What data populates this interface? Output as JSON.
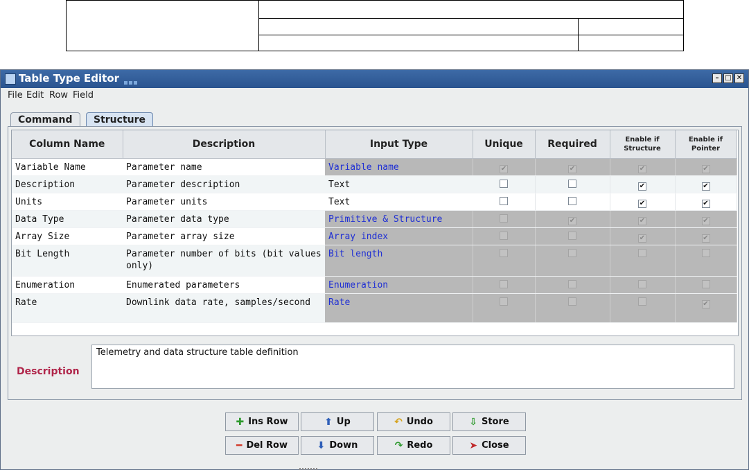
{
  "window": {
    "title": "Table Type Editor",
    "controls": [
      "–",
      "□",
      "✕"
    ]
  },
  "menu": [
    "File",
    "Edit",
    "Row",
    "Field"
  ],
  "tabs": [
    {
      "label": "Command",
      "active": false
    },
    {
      "label": "Structure",
      "active": true
    }
  ],
  "table": {
    "headers": {
      "column_name": "Column Name",
      "description": "Description",
      "input_type": "Input Type",
      "unique": "Unique",
      "required": "Required",
      "enable_structure_1": "Enable if",
      "enable_structure_2": "Structure",
      "enable_pointer_1": "Enable if",
      "enable_pointer_2": "Pointer"
    },
    "rows": [
      {
        "name": "Variable Name",
        "description": "Parameter name",
        "input_type": "Variable name",
        "input_blue": true,
        "flags": [
          {
            "checked": true,
            "disabled": true
          },
          {
            "checked": true,
            "disabled": true
          },
          {
            "checked": true,
            "disabled": true
          },
          {
            "checked": true,
            "disabled": true
          }
        ]
      },
      {
        "name": "Description",
        "description": "Parameter description",
        "input_type": "Text",
        "input_blue": false,
        "flags": [
          {
            "checked": false,
            "disabled": false
          },
          {
            "checked": false,
            "disabled": false
          },
          {
            "checked": true,
            "disabled": false
          },
          {
            "checked": true,
            "disabled": false
          }
        ]
      },
      {
        "name": "Units",
        "description": "Parameter units",
        "input_type": "Text",
        "input_blue": false,
        "flags": [
          {
            "checked": false,
            "disabled": false
          },
          {
            "checked": false,
            "disabled": false
          },
          {
            "checked": true,
            "disabled": false
          },
          {
            "checked": true,
            "disabled": false
          }
        ]
      },
      {
        "name": "Data Type",
        "description": "Parameter data type",
        "input_type": "Primitive & Structure",
        "input_blue": true,
        "flags": [
          {
            "checked": false,
            "disabled": true
          },
          {
            "checked": true,
            "disabled": true
          },
          {
            "checked": true,
            "disabled": true
          },
          {
            "checked": true,
            "disabled": true
          }
        ]
      },
      {
        "name": "Array Size",
        "description": "Parameter array size",
        "input_type": "Array index",
        "input_blue": true,
        "flags": [
          {
            "checked": false,
            "disabled": true
          },
          {
            "checked": false,
            "disabled": true
          },
          {
            "checked": true,
            "disabled": true
          },
          {
            "checked": true,
            "disabled": true
          }
        ]
      },
      {
        "name": "Bit Length",
        "description": "Parameter number of bits (bit values only)",
        "input_type": "Bit length",
        "input_blue": true,
        "flags": [
          {
            "checked": false,
            "disabled": true
          },
          {
            "checked": false,
            "disabled": true
          },
          {
            "checked": false,
            "disabled": true
          },
          {
            "checked": false,
            "disabled": true
          }
        ]
      },
      {
        "name": "Enumeration",
        "description": "Enumerated parameters",
        "input_type": "Enumeration",
        "input_blue": true,
        "flags": [
          {
            "checked": false,
            "disabled": true
          },
          {
            "checked": false,
            "disabled": true
          },
          {
            "checked": false,
            "disabled": true
          },
          {
            "checked": false,
            "disabled": true
          }
        ]
      },
      {
        "name": "Rate",
        "description": "Downlink data rate, samples/second",
        "input_type": "Rate",
        "input_blue": true,
        "flags": [
          {
            "checked": false,
            "disabled": true
          },
          {
            "checked": false,
            "disabled": true
          },
          {
            "checked": false,
            "disabled": true
          },
          {
            "checked": true,
            "disabled": true
          }
        ]
      }
    ]
  },
  "description": {
    "label": "Description",
    "value": "Telemetry and data structure table definition"
  },
  "buttons": [
    {
      "id": "ins-row",
      "label": "Ins Row",
      "icon": "plus-icon",
      "glyph": "✚",
      "color": "#2f9a2f"
    },
    {
      "id": "up",
      "label": "Up",
      "icon": "arrow-up-icon",
      "glyph": "⬆",
      "color": "#2f5fb8"
    },
    {
      "id": "undo",
      "label": "Undo",
      "icon": "undo-icon",
      "glyph": "↶",
      "color": "#d6a21a"
    },
    {
      "id": "store",
      "label": "Store",
      "icon": "store-icon",
      "glyph": "⇩",
      "color": "#2f9a2f"
    },
    {
      "id": "del-row",
      "label": "Del Row",
      "icon": "minus-icon",
      "glyph": "━",
      "color": "#d23a2a"
    },
    {
      "id": "down",
      "label": "Down",
      "icon": "arrow-down-icon",
      "glyph": "⬇",
      "color": "#2f5fb8"
    },
    {
      "id": "redo",
      "label": "Redo",
      "icon": "redo-icon",
      "glyph": "↷",
      "color": "#2f9a2f"
    },
    {
      "id": "close",
      "label": "Close",
      "icon": "exit-icon",
      "glyph": "➤",
      "color": "#c0282a"
    }
  ]
}
